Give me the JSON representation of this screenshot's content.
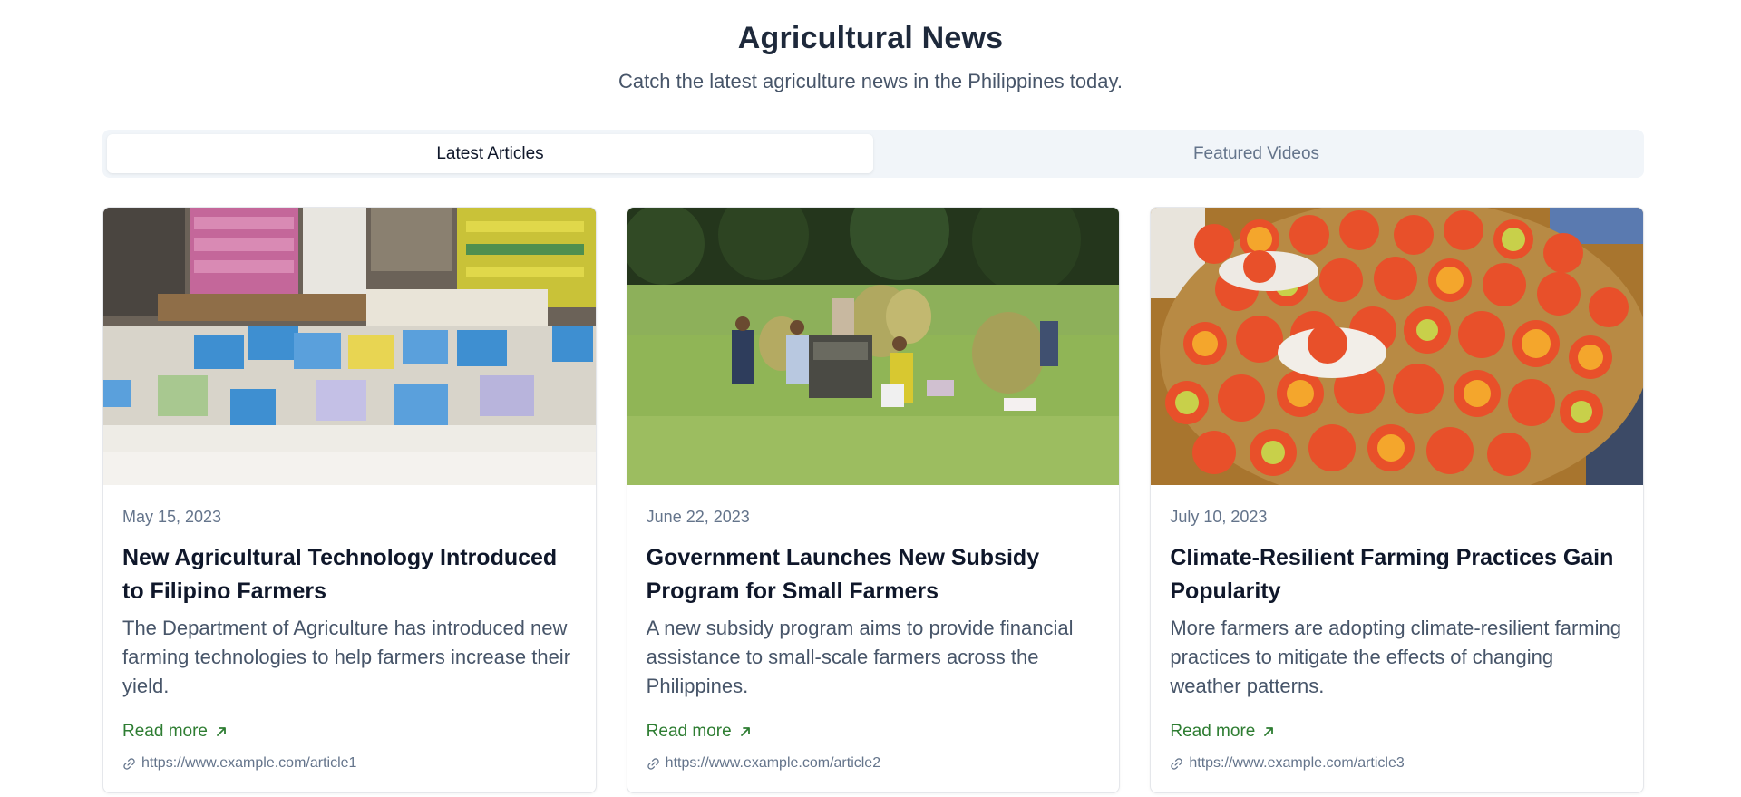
{
  "header": {
    "title": "Agricultural News",
    "subtitle": "Catch the latest agriculture news in the Philippines today."
  },
  "tabs": [
    {
      "label": "Latest Articles",
      "active": true
    },
    {
      "label": "Featured Videos",
      "active": false
    }
  ],
  "articles": [
    {
      "date": "May 15, 2023",
      "title": "New Agricultural Technology Introduced to Filipino Farmers",
      "excerpt": "The Department of Agriculture has introduced new farming technologies to help farmers increase their yield.",
      "read_more": "Read more",
      "url": "https://www.example.com/article1",
      "image": "rice-market-photo"
    },
    {
      "date": "June 22, 2023",
      "title": "Government Launches New Subsidy Program for Small Farmers",
      "excerpt": "A new subsidy program aims to provide financial assistance to small-scale farmers across the Philippines.",
      "read_more": "Read more",
      "url": "https://www.example.com/article2",
      "image": "rice-harvest-photo"
    },
    {
      "date": "July 10, 2023",
      "title": "Climate-Resilient Farming Practices Gain Popularity",
      "excerpt": "More farmers are adopting climate-resilient farming practices to mitigate the effects of changing weather patterns.",
      "read_more": "Read more",
      "url": "https://www.example.com/article3",
      "image": "tomatoes-basket-photo"
    }
  ],
  "colors": {
    "accent_green": "#2e7d32",
    "title": "#1e293b",
    "muted": "#64748b",
    "tab_bg": "#f1f5f9"
  }
}
